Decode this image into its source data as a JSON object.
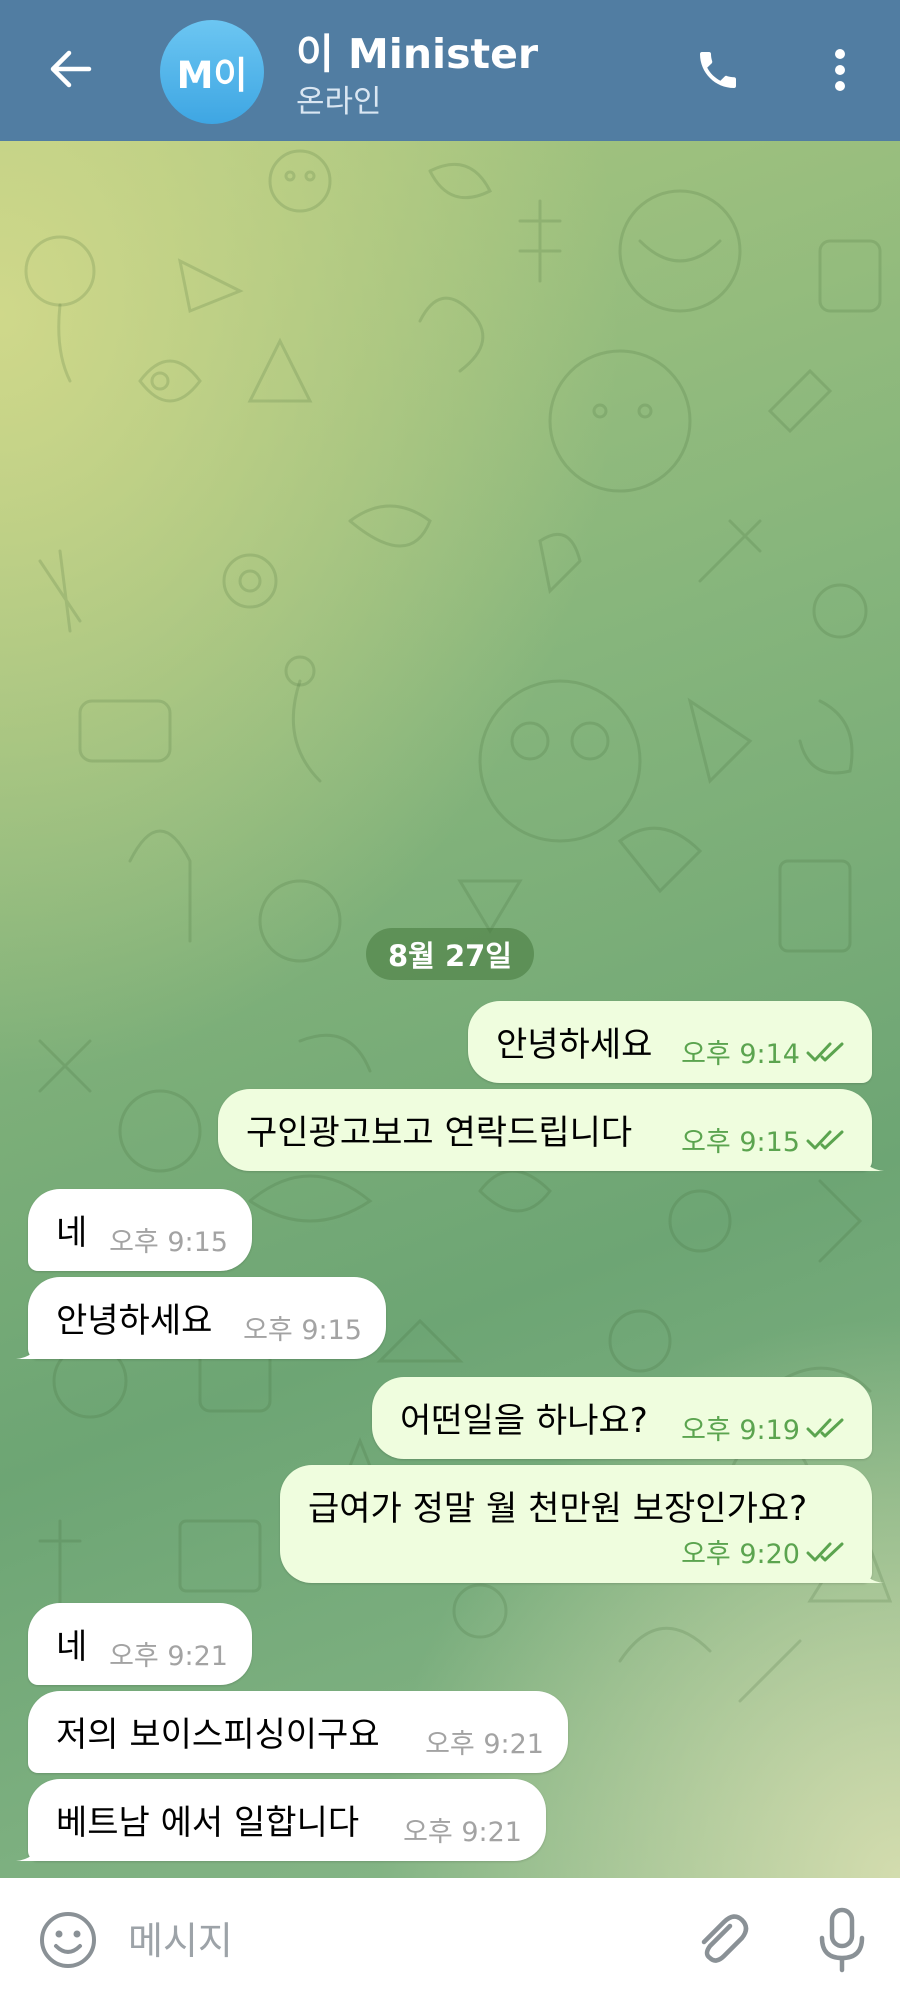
{
  "header": {
    "avatar_initials": "M이",
    "title": "이 Minister",
    "status": "온라인",
    "back_icon": "arrow-left-icon",
    "call_icon": "phone-icon",
    "menu_icon": "more-vertical-icon",
    "color": "#517da2"
  },
  "chat": {
    "date": "8월 27일",
    "messages": [
      {
        "direction": "out",
        "text": "안녕하세요",
        "time": "오후 9:14",
        "read": true
      },
      {
        "direction": "out",
        "text": "구인광고보고 연락드립니다",
        "time": "오후 9:15",
        "read": true
      },
      {
        "direction": "in",
        "text": "네",
        "time": "오후 9:15"
      },
      {
        "direction": "in",
        "text": "안녕하세요",
        "time": "오후 9:15"
      },
      {
        "direction": "out",
        "text": "어떤일을 하나요?",
        "time": "오후 9:19",
        "read": true
      },
      {
        "direction": "out",
        "text": "급여가 정말 월 천만원 보장인가요?",
        "time": "오후 9:20",
        "read": true
      },
      {
        "direction": "in",
        "text": "네",
        "time": "오후 9:21"
      },
      {
        "direction": "in",
        "text": "저의 보이스피싱이구요",
        "time": "오후 9:21"
      },
      {
        "direction": "in",
        "text": "베트남 에서 일합니다",
        "time": "오후 9:21"
      }
    ],
    "outgoing_bubble_color": "#effdde",
    "incoming_bubble_color": "#ffffff",
    "read_check_color": "#5ba44f"
  },
  "input": {
    "placeholder": "메시지",
    "emoji_icon": "emoji-smile-icon",
    "attach_icon": "paperclip-icon",
    "mic_icon": "microphone-icon"
  }
}
